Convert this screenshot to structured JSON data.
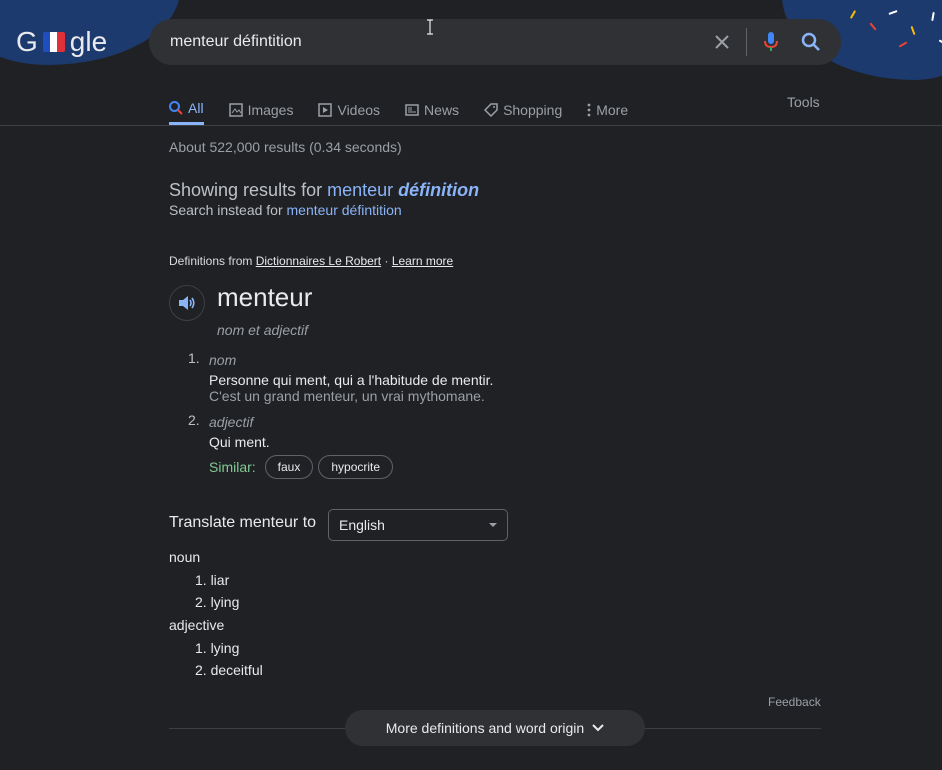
{
  "colors": {
    "background": "#202124",
    "accent": "#8ab4f8",
    "similar_label": "#81c995",
    "text": "#e8eaed"
  },
  "header": {
    "logo_first": "G",
    "logo_rest": "gle",
    "search_query": "menteur défintition",
    "icons": [
      "clear-icon",
      "microphone-icon",
      "search-icon"
    ]
  },
  "tabs": [
    {
      "label": "All",
      "icon": "search-icon",
      "active": true
    },
    {
      "label": "Images",
      "icon": "image-icon"
    },
    {
      "label": "Videos",
      "icon": "video-icon"
    },
    {
      "label": "News",
      "icon": "news-icon"
    },
    {
      "label": "Shopping",
      "icon": "tag-icon"
    },
    {
      "label": "More",
      "icon": "more-vert-icon"
    }
  ],
  "tools_label": "Tools",
  "result_stats": "About 522,000 results (0.34 seconds)",
  "spelling": {
    "showing_prefix": "Showing results for",
    "corrected_word1": "menteur",
    "corrected_word2": "définition",
    "instead_prefix": "Search instead for",
    "original_query": "menteur défintition"
  },
  "dictionary": {
    "defs_from_prefix": "Definitions from",
    "source": "Dictionnaires Le Robert",
    "separator": "·",
    "learn_more": "Learn more",
    "word": "menteur",
    "part_of_speech": "nom et adjectif",
    "senses": [
      {
        "num": "1.",
        "pos": "nom",
        "meaning": "Personne qui ment, qui a l'habitude de mentir.",
        "example": "C'est un grand menteur, un vrai mythomane."
      },
      {
        "num": "2.",
        "pos": "adjectif",
        "meaning": "Qui ment.",
        "example": ""
      }
    ],
    "similar_label": "Similar:",
    "similar": [
      "faux",
      "hypocrite"
    ]
  },
  "translate": {
    "label": "Translate menteur to",
    "language": "English",
    "groups": [
      {
        "pos": "noun",
        "items": [
          "1. liar",
          "2. lying"
        ]
      },
      {
        "pos": "adjective",
        "items": [
          "1. lying",
          "2. deceitful"
        ]
      }
    ]
  },
  "feedback": "Feedback",
  "more_button": "More definitions and word origin"
}
